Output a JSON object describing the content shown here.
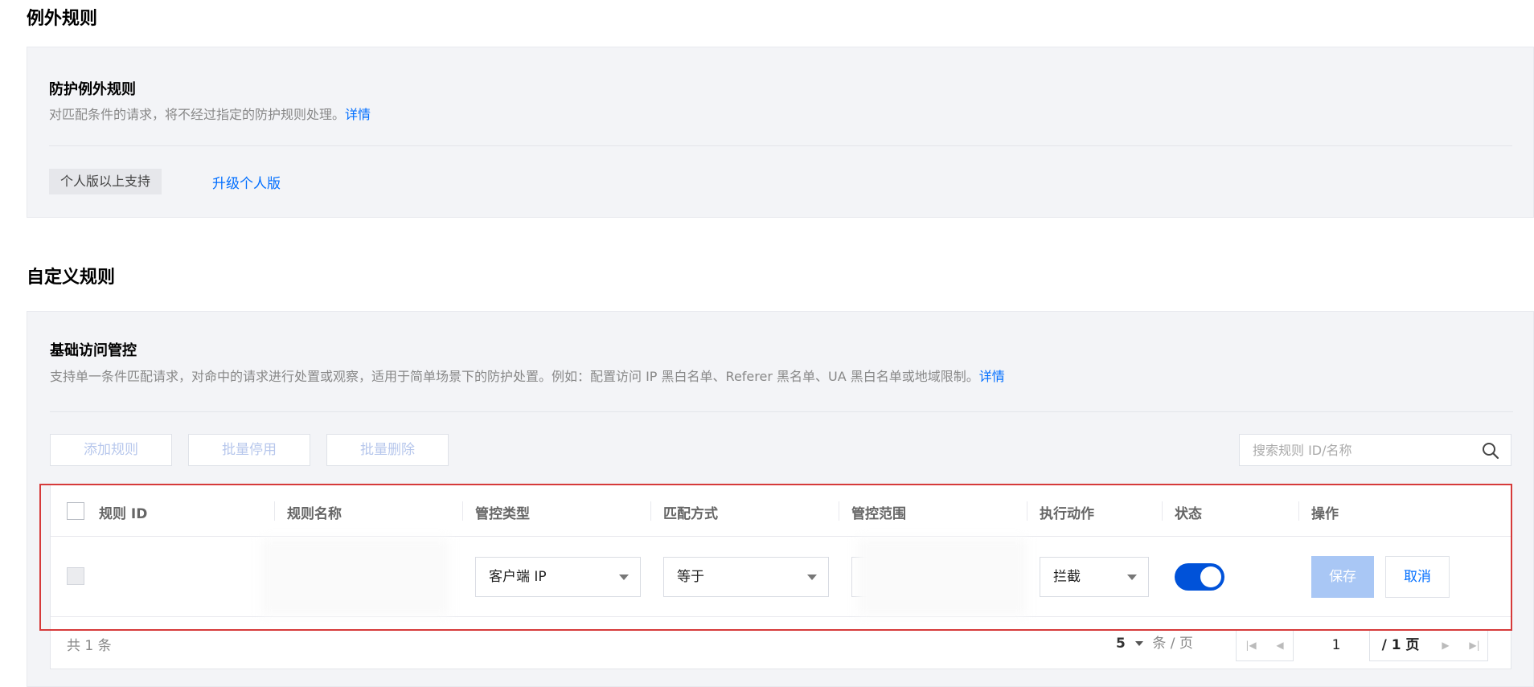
{
  "sections": {
    "exception_title": "例外规则",
    "custom_title": "自定义规则"
  },
  "exception_card": {
    "title": "防护例外规则",
    "desc": "对匹配条件的请求，将不经过指定的防护规则处理。",
    "detail_link": "详情",
    "badge": "个人版以上支持",
    "upgrade_link": "升级个人版"
  },
  "basic_card": {
    "title": "基础访问管控",
    "desc": "支持单一条件匹配请求，对命中的请求进行处置或观察，适用于简单场景下的防护处置。例如：配置访问 IP 黑白名单、Referer 黑名单、UA 黑白名单或地域限制。",
    "detail_link": "详情"
  },
  "toolbar": {
    "add_label": "添加规则",
    "disable_label": "批量停用",
    "delete_label": "批量删除",
    "search_placeholder": "搜索规则 ID/名称"
  },
  "table": {
    "columns": [
      "规则 ID",
      "规则名称",
      "管控类型",
      "匹配方式",
      "管控范围",
      "执行动作",
      "状态",
      "操作"
    ],
    "row": {
      "control_type": "客户端 IP",
      "match_mode": "等于",
      "action": "拦截",
      "status_on": true,
      "save_label": "保存",
      "cancel_label": "取消"
    }
  },
  "footer": {
    "total": "共 1 条",
    "page_size": "5",
    "page_size_unit": "条 / 页",
    "current_page": "1",
    "total_pages": "/ 1 页"
  },
  "colors": {
    "link": "#006eff",
    "toggle": "#0052d9",
    "highlight_border": "#d63a3a"
  }
}
